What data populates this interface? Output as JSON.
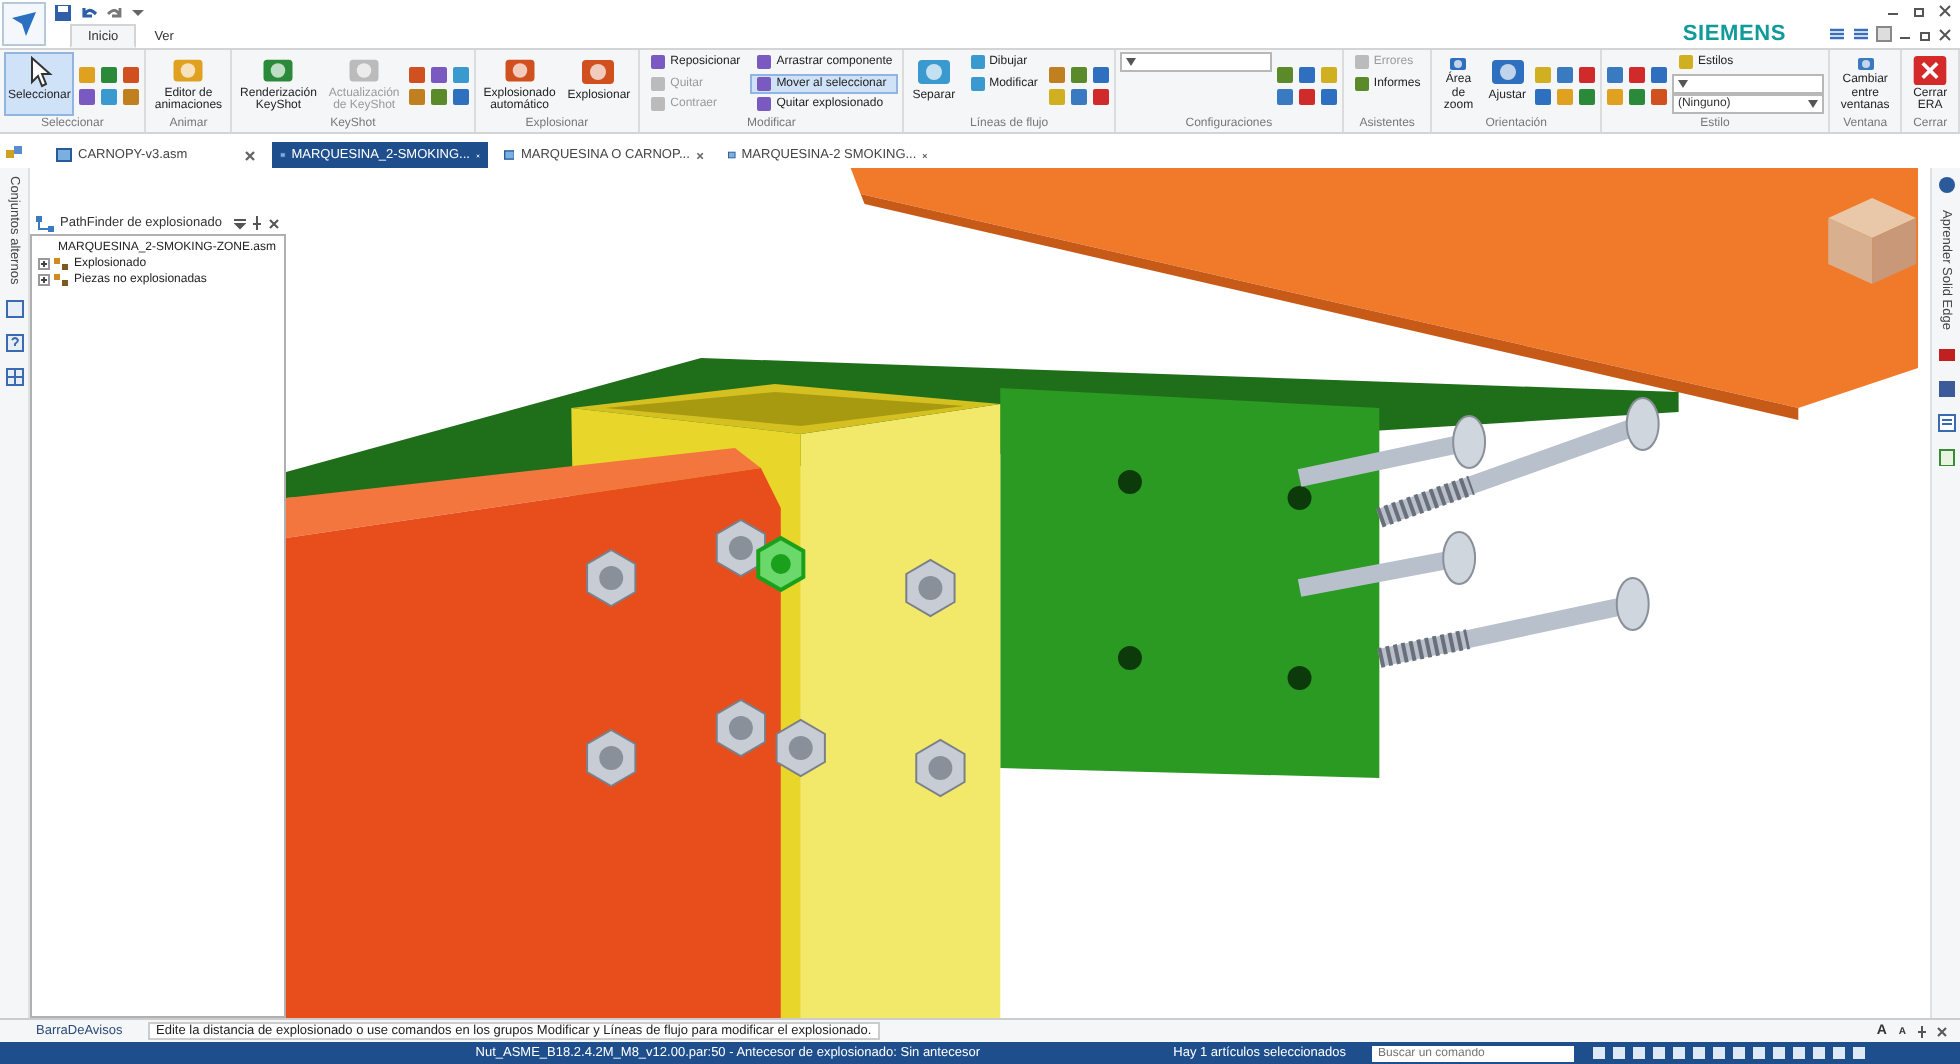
{
  "ribbon_tabs": [
    {
      "label": "Inicio",
      "selected": true
    },
    {
      "label": "Ver",
      "selected": false
    }
  ],
  "brand": "SIEMENS",
  "ribbon_groups": [
    {
      "label": "Seleccionar",
      "buttons": [
        {
          "kind": "large",
          "label": "Seleccionar",
          "selected": true,
          "disabled": false
        },
        {
          "kind": "icon-grid"
        }
      ]
    },
    {
      "label": "Animar",
      "buttons": [
        {
          "kind": "large",
          "label": "Editor de animaciones",
          "selected": false,
          "disabled": false
        }
      ]
    },
    {
      "label": "KeyShot",
      "buttons": [
        {
          "kind": "large",
          "label": "Renderización KeyShot",
          "selected": false,
          "disabled": false
        },
        {
          "kind": "large",
          "label": "Actualización de KeyShot",
          "selected": false,
          "disabled": true
        },
        {
          "kind": "icon-grid"
        }
      ]
    },
    {
      "label": "Explosionar",
      "buttons": [
        {
          "kind": "large",
          "label": "Explosionado automático",
          "selected": false,
          "disabled": false
        },
        {
          "kind": "large",
          "label": "Explosionar",
          "selected": false,
          "disabled": false
        }
      ]
    },
    {
      "label": "Modificar",
      "buttons": [
        {
          "kind": "small",
          "label": "Reposicionar",
          "selected": false,
          "disabled": false
        },
        {
          "kind": "small",
          "label": "Quitar",
          "selected": false,
          "disabled": true
        },
        {
          "kind": "small",
          "label": "Contraer",
          "selected": false,
          "disabled": true
        },
        {
          "kind": "small",
          "label": "Arrastrar componente",
          "selected": false,
          "disabled": false
        },
        {
          "kind": "small",
          "label": "Mover al seleccionar",
          "selected": true,
          "disabled": false
        },
        {
          "kind": "small",
          "label": "Quitar explosionado",
          "selected": false,
          "disabled": false
        }
      ]
    },
    {
      "label": "Líneas de flujo",
      "buttons": [
        {
          "kind": "large",
          "label": "Separar",
          "selected": false,
          "disabled": false
        },
        {
          "kind": "small",
          "label": "Dibujar",
          "selected": false,
          "disabled": false
        },
        {
          "kind": "small",
          "label": "Modificar",
          "selected": false,
          "disabled": false
        },
        {
          "kind": "icon-grid"
        }
      ]
    },
    {
      "label": "Configuraciones",
      "buttons": [
        {
          "kind": "dropdown"
        },
        {
          "kind": "icon-grid"
        }
      ]
    },
    {
      "label": "Asistentes",
      "buttons": [
        {
          "kind": "small",
          "label": "Errores",
          "selected": false,
          "disabled": true
        },
        {
          "kind": "small",
          "label": "Informes",
          "selected": false,
          "disabled": false
        }
      ]
    },
    {
      "label": "Orientación",
      "buttons": [
        {
          "kind": "large",
          "label": "Área de zoom",
          "selected": false,
          "disabled": false
        },
        {
          "kind": "large",
          "label": "Ajustar",
          "selected": false,
          "disabled": false
        },
        {
          "kind": "icon-grid"
        }
      ]
    },
    {
      "label": "Estilo",
      "buttons": [
        {
          "kind": "icon-grid"
        },
        {
          "kind": "small",
          "label": "Estilos",
          "selected": false,
          "disabled": false
        },
        {
          "kind": "dropdown"
        },
        {
          "kind": "dropdown",
          "value": "(Ninguno)"
        }
      ]
    },
    {
      "label": "Ventana",
      "buttons": [
        {
          "kind": "large",
          "label": "Cambiar entre ventanas",
          "selected": false,
          "disabled": false
        }
      ]
    },
    {
      "label": "Cerrar",
      "buttons": [
        {
          "kind": "large",
          "label": "Cerrar ERA",
          "selected": false,
          "disabled": false
        }
      ]
    }
  ],
  "document_tabs": [
    {
      "label": "CARNOPY-v3.asm",
      "selected": false
    },
    {
      "label": "MARQUESINA_2-SMOKING...",
      "selected": true
    },
    {
      "label": "MARQUESINA O CARNOP...",
      "selected": false
    },
    {
      "label": "MARQUESINA-2 SMOKING...",
      "selected": false
    }
  ],
  "left_rail": {
    "label": "Conjuntos alternos"
  },
  "right_rail": {
    "label": "Aprender Solid Edge"
  },
  "pathfinder": {
    "title": "PathFinder de explosionado",
    "tree": [
      {
        "label": "MARQUESINA_2-SMOKING-ZONE.asm",
        "children": [
          {
            "label": "Explosionado",
            "expanded": false
          },
          {
            "label": "Piezas no explosionadas",
            "expanded": false
          }
        ]
      }
    ]
  },
  "message_bar": {
    "label": "BarraDeAvisos",
    "message": "Edite la distancia de explosionado o use comandos en los grupos Modificar y Líneas de flujo para modificar el explosionado.",
    "font_buttons": [
      "A",
      "A"
    ]
  },
  "status_bar": {
    "file_info": "Nut_ASME_B18.2.4.2M_M8_v12.00.par:50 - Antecesor de explosionado: Sin antecesor",
    "selection": "Hay 1 artículos seleccionados",
    "command_search": {
      "placeholder": "Buscar un comando"
    }
  }
}
